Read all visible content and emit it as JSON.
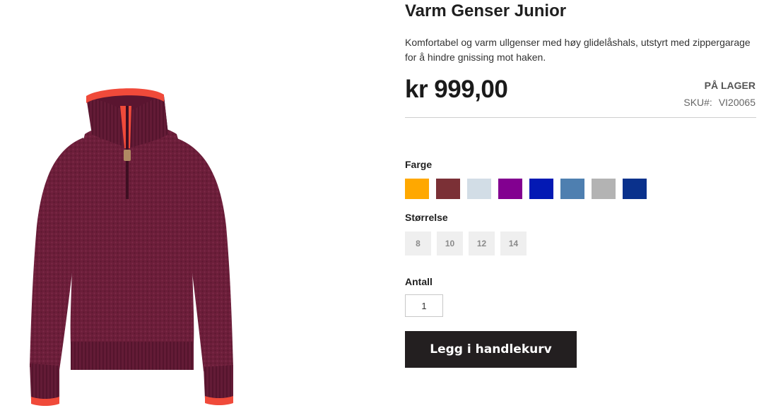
{
  "product": {
    "title": "Varm Genser Junior",
    "description": "Komfortabel og varm ullgenser med høy glidelåshals, utstyrt med zippergarage for å hindre gnissing mot haken.",
    "price": "kr 999,00",
    "stock_status": "PÅ LAGER",
    "sku_label": "SKU#:",
    "sku_value": "VI20065",
    "image_colors": {
      "body": "#6e1f3c",
      "collar_trim": "#f04a3a",
      "zipper": "#b08a63"
    }
  },
  "color_option": {
    "label": "Farge",
    "swatches": [
      {
        "color": "#ffa800"
      },
      {
        "color": "#7b3036"
      },
      {
        "color": "#d2dde6"
      },
      {
        "color": "#820090"
      },
      {
        "color": "#0319b4"
      },
      {
        "color": "#4e7fb0"
      },
      {
        "color": "#b3b3b3"
      },
      {
        "color": "#0a318c"
      }
    ]
  },
  "size_option": {
    "label": "Størrelse",
    "sizes": [
      "8",
      "10",
      "12",
      "14"
    ]
  },
  "quantity": {
    "label": "Antall",
    "value": "1"
  },
  "add_to_cart": {
    "label": "Legg i handlekurv"
  }
}
